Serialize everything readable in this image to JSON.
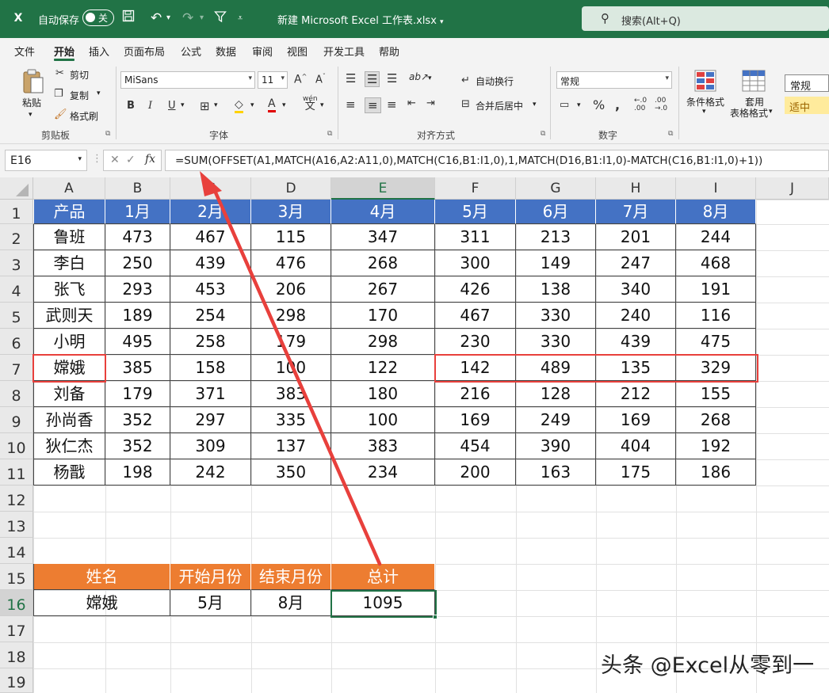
{
  "titlebar": {
    "excel_logo": "X",
    "autosave_label": "自动保存",
    "autosave_state": "关",
    "file_title": "新建 Microsoft Excel 工作表.xlsx",
    "search_placeholder": "搜索(Alt+Q)"
  },
  "menu": [
    "文件",
    "开始",
    "插入",
    "页面布局",
    "公式",
    "数据",
    "审阅",
    "视图",
    "开发工具",
    "帮助"
  ],
  "ribbon": {
    "clipboard": {
      "paste": "粘贴",
      "cut": "剪切",
      "copy": "复制",
      "format_painter": "格式刷",
      "title": "剪贴板"
    },
    "font": {
      "name": "MiSans",
      "size": "11",
      "bold": "B",
      "italic": "I",
      "underline": "U",
      "title": "字体"
    },
    "align": {
      "wrap": "自动换行",
      "merge": "合并后居中",
      "title": "对齐方式"
    },
    "number": {
      "format": "常规",
      "percent": "%",
      "title": "数字"
    },
    "styles": {
      "conditional": "条件格式",
      "table1": "套用",
      "table2": "表格格式",
      "style_normal": "常规",
      "style_neutral": "适中"
    }
  },
  "formula_bar": {
    "cell_ref": "E16",
    "fx": "fx",
    "formula": "=SUM(OFFSET(A1,MATCH(A16,A2:A11,0),MATCH(C16,B1:I1,0),1,MATCH(D16,B1:I1,0)-MATCH(C16,B1:I1,0)+1))"
  },
  "columns": [
    "A",
    "B",
    "C",
    "D",
    "E",
    "F",
    "G",
    "H",
    "I",
    "J"
  ],
  "rows": [
    "1",
    "2",
    "3",
    "4",
    "5",
    "6",
    "7",
    "8",
    "9",
    "10",
    "11",
    "12",
    "13",
    "14",
    "15",
    "16",
    "17",
    "18",
    "19"
  ],
  "table": {
    "header": [
      "产品",
      "1月",
      "2月",
      "3月",
      "4月",
      "5月",
      "6月",
      "7月",
      "8月"
    ],
    "rows": [
      [
        "鲁班",
        "473",
        "467",
        "115",
        "347",
        "311",
        "213",
        "201",
        "244"
      ],
      [
        "李白",
        "250",
        "439",
        "476",
        "268",
        "300",
        "149",
        "247",
        "468"
      ],
      [
        "张飞",
        "293",
        "453",
        "206",
        "267",
        "426",
        "138",
        "340",
        "191"
      ],
      [
        "武则天",
        "189",
        "254",
        "298",
        "170",
        "467",
        "330",
        "240",
        "116"
      ],
      [
        "小明",
        "495",
        "258",
        "179",
        "298",
        "230",
        "330",
        "439",
        "475"
      ],
      [
        "嫦娥",
        "385",
        "158",
        "100",
        "122",
        "142",
        "489",
        "135",
        "329"
      ],
      [
        "刘备",
        "179",
        "371",
        "383",
        "180",
        "216",
        "128",
        "212",
        "155"
      ],
      [
        "孙尚香",
        "352",
        "297",
        "335",
        "100",
        "169",
        "249",
        "169",
        "268"
      ],
      [
        "狄仁杰",
        "352",
        "309",
        "137",
        "383",
        "454",
        "390",
        "404",
        "192"
      ],
      [
        "杨戬",
        "198",
        "242",
        "350",
        "234",
        "200",
        "163",
        "175",
        "186"
      ]
    ]
  },
  "lookup": {
    "header": [
      "姓名",
      "开始月份",
      "结束月份",
      "总计"
    ],
    "row": [
      "嫦娥",
      "5月",
      "8月",
      "1095"
    ]
  },
  "watermark": "头条 @Excel从零到一",
  "colors": {
    "excel_green": "#217346",
    "header_blue": "#4472c4",
    "header_orange": "#ed7d31",
    "annotation_red": "#e8403c"
  }
}
